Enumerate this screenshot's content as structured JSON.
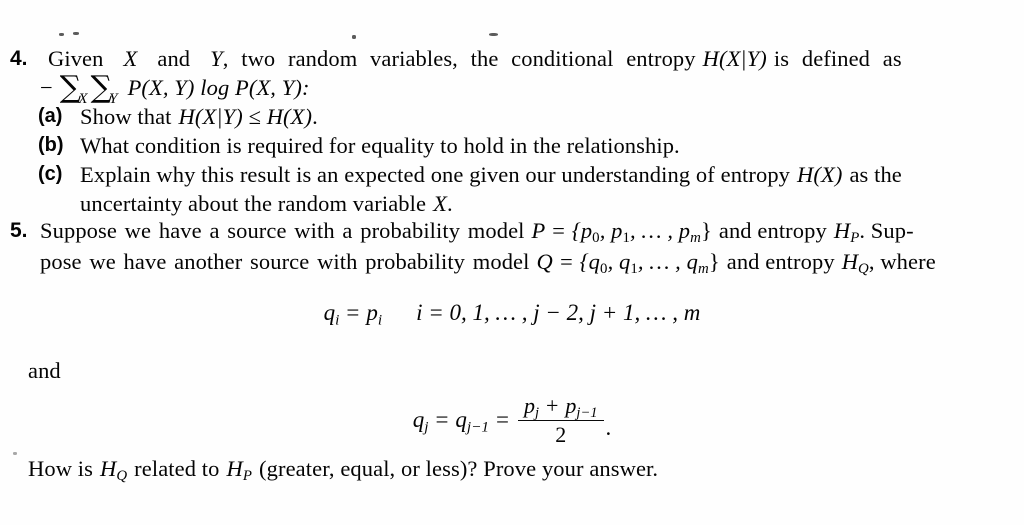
{
  "page": {
    "background_color": "#fefefe",
    "text_color": "#0b0b0b",
    "type": "scanned-textbook-exercises"
  },
  "exercises": [
    {
      "marker": "4.",
      "lead_line_1_a": "Given",
      "lead_line_1_b": "and",
      "lead_line_1_c": ", two random variables, the conditional entropy",
      "lead_line_1_d": "is defined as",
      "var_x": "X",
      "var_y": "Y",
      "entropy_cond": "H(X|Y)",
      "lead_line_2_minus": "−",
      "lead_line_2_sum_sub_x": "X",
      "lead_line_2_sum_sub_y": "Y",
      "lead_line_2_body": "P(X, Y) log P(X, Y):",
      "subitems": [
        {
          "label": "(a)",
          "text_before": "Show that",
          "formula": "H(X|Y) ≤ H(X)",
          "text_after": "."
        },
        {
          "label": "(b)",
          "text": "What condition is required for equality to hold in the relationship."
        },
        {
          "label": "(c)",
          "line1_before": "Explain why this result is an expected one given our understanding of entropy",
          "line1_formula": "H(X)",
          "line1_after": "as the",
          "line2_before": "uncertainty about the random variable",
          "line2_formula": "X",
          "line2_after": "."
        }
      ]
    },
    {
      "marker": "5.",
      "line1": {
        "t1": "Suppose we have a source with a probability model",
        "eq_p": "P = {p",
        "p_sub_0": "0",
        "p_comma1": ", p",
        "p_sub_1": "1",
        "p_dots": ", … , p",
        "p_sub_m": "m",
        "p_close": "}",
        "t2": "and entropy",
        "h_p": "H",
        "h_p_sub": "P",
        "t3": ". Sup-"
      },
      "line2": {
        "t1": "pose we have another source with probability model",
        "eq_q": "Q = {q",
        "q_sub_0": "0",
        "q_comma1": ", q",
        "q_sub_1": "1",
        "q_dots": ", … , q",
        "q_sub_m": "m",
        "q_close": "}",
        "t2": "and entropy",
        "h_q": "H",
        "h_q_sub": "Q",
        "t3": ", where"
      },
      "equation_1": {
        "lhs_q": "q",
        "lhs_q_sub": "i",
        "eq": "=",
        "rhs_p": "p",
        "rhs_p_sub": "i",
        "condition": "i = 0, 1, … , j − 2, j + 1, … , m"
      },
      "connector": "and",
      "equation_2": {
        "lhs_q": "q",
        "lhs_q_sub": "j",
        "eq1": "=",
        "mid_q": "q",
        "mid_q_sub": "j−1",
        "eq2": "=",
        "num_p1": "p",
        "num_p1_sub": "j",
        "num_plus": "+",
        "num_p2": "p",
        "num_p2_sub": "j−1",
        "den": "2",
        "period": "."
      },
      "closing": {
        "t1": "How is",
        "h_q": "H",
        "h_q_sub": "Q",
        "t2": "related to",
        "h_p": "H",
        "h_p_sub": "P",
        "t3": "(greater, equal, or less)? Prove your answer."
      }
    }
  ]
}
